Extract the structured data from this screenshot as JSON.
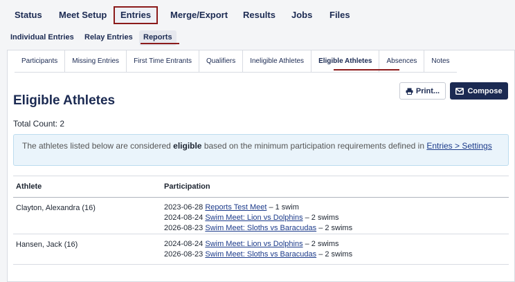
{
  "top_nav": {
    "items": [
      "Status",
      "Meet Setup",
      "Entries",
      "Merge/Export",
      "Results",
      "Jobs",
      "Files"
    ]
  },
  "sub_nav": {
    "items": [
      "Individual Entries",
      "Relay Entries",
      "Reports"
    ]
  },
  "report_tabs": {
    "items": [
      "Participants",
      "Missing Entries",
      "First Time Entrants",
      "Qualifiers",
      "Ineligible Athletes",
      "Eligible Athletes",
      "Absences",
      "Notes"
    ]
  },
  "page": {
    "title": "Eligible Athletes",
    "print_label": "Print...",
    "compose_label": "Compose",
    "total_count": "Total Count: 2"
  },
  "info": {
    "prefix": "The athletes listed below are considered ",
    "bold": "eligible",
    "middle": " based on the minimum participation requirements defined in ",
    "link": "Entries > Settings"
  },
  "table": {
    "headers": [
      "Athlete",
      "Participation"
    ],
    "rows": [
      {
        "athlete": "Clayton, Alexandra (16)",
        "entries": [
          {
            "date": "2023-06-28",
            "meet": "Reports Test Meet",
            "count": " – 1 swim"
          },
          {
            "date": "2024-08-24",
            "meet": "Swim Meet: Lion vs Dolphins",
            "count": " – 2 swims"
          },
          {
            "date": "2026-08-23",
            "meet": "Swim Meet: Sloths vs Baracudas",
            "count": " – 2 swims"
          }
        ]
      },
      {
        "athlete": "Hansen, Jack (16)",
        "entries": [
          {
            "date": "2024-08-24",
            "meet": "Swim Meet: Lion vs Dolphins",
            "count": " – 2 swims"
          },
          {
            "date": "2026-08-23",
            "meet": "Swim Meet: Sloths vs Baracudas",
            "count": " – 2 swims"
          }
        ]
      }
    ]
  }
}
